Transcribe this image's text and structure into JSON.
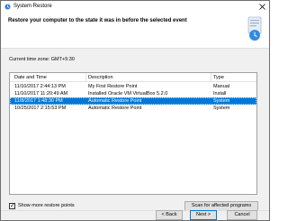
{
  "window": {
    "title": "System Restore",
    "close_label": "×"
  },
  "header": {
    "title": "Restore your computer to the state it was in before the selected event"
  },
  "timezone": {
    "label": "Current time zone: GMT+5:30"
  },
  "table": {
    "columns": [
      "Date and Time",
      "Description",
      "Type"
    ],
    "rows": [
      {
        "date": "11/10/2017 2:44:13 PM",
        "description": "My First Restore Point",
        "type": "Manual",
        "selected": false
      },
      {
        "date": "11/10/2017 11:20:49 AM",
        "description": "Installed Oracle VM VirtualBox 5.2.0",
        "type": "Install",
        "selected": false
      },
      {
        "date": "11/8/2017 1:48:30 PM",
        "description": "Automatic Restore Point",
        "type": "System",
        "selected": true
      },
      {
        "date": "10/25/2017 2:15:53 PM",
        "description": "Automatic Restore Point",
        "type": "System",
        "selected": false
      }
    ]
  },
  "options": {
    "show_more_label": "Show more restore points",
    "show_more_checked": true,
    "scan_label": "Scan for affected programs"
  },
  "footer": {
    "back_label": "< Back",
    "next_label": "Next >",
    "cancel_label": "Cancel"
  },
  "colors": {
    "selection": "#0078d7",
    "window_bg": "#f0f0f0"
  },
  "icons": {
    "title": "system-restore-icon",
    "header": "restore-shield-icon",
    "close": "close-icon"
  }
}
